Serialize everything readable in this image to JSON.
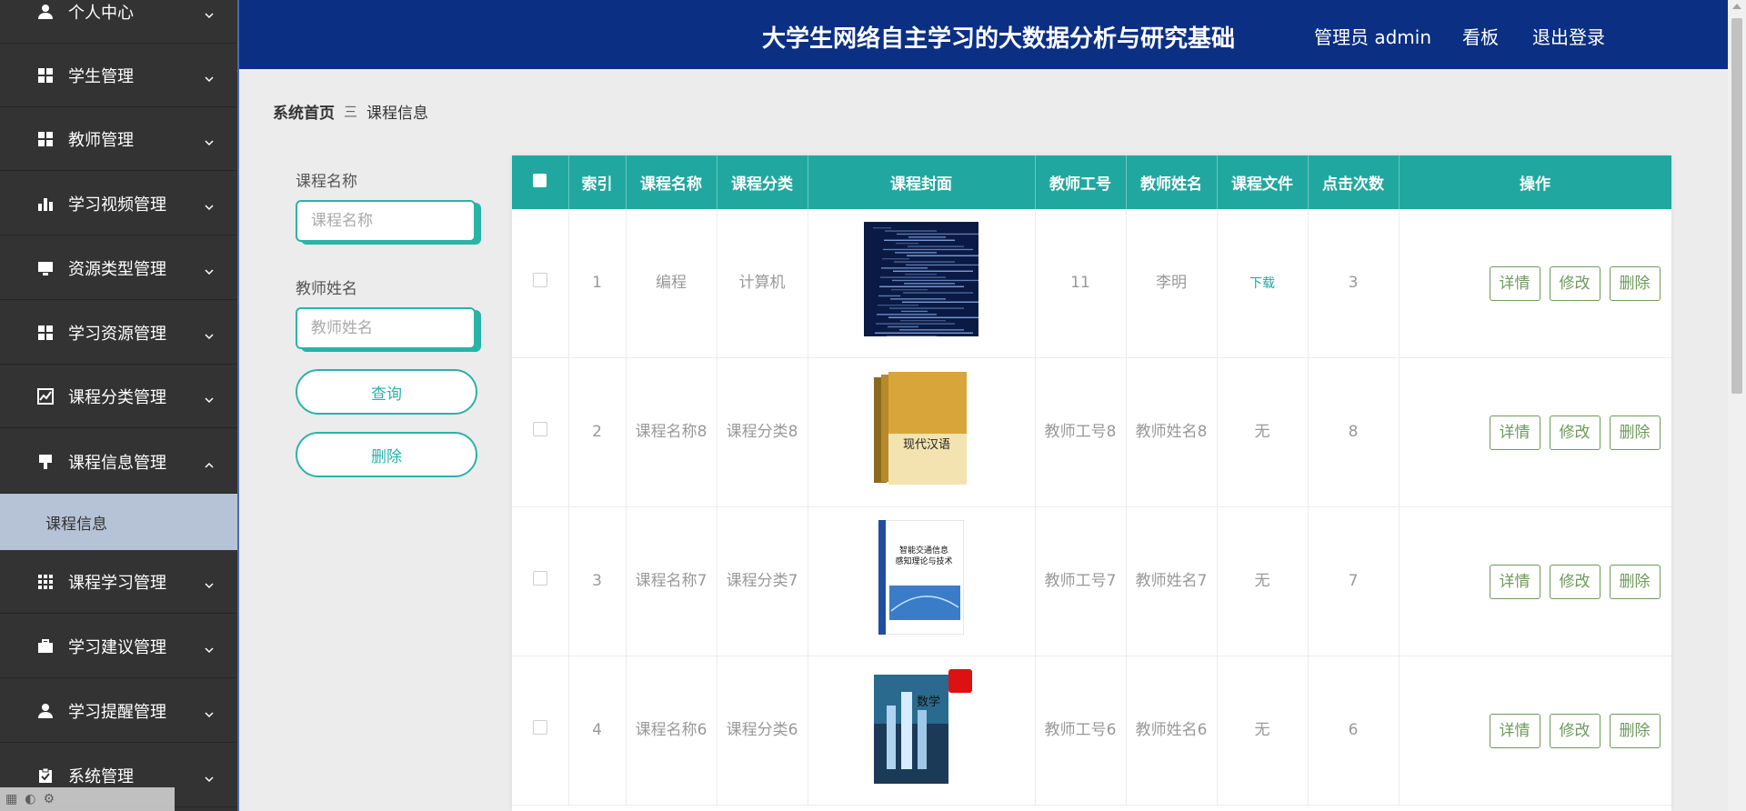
{
  "header": {
    "title": "大学生网络自主学习的大数据分析与研究基础",
    "admin": "管理员 admin",
    "dashboard": "看板",
    "logout": "退出登录"
  },
  "sidebar": {
    "items": [
      {
        "label": "个人中心",
        "icon": "user-icon"
      },
      {
        "label": "学生管理",
        "icon": "grid-icon"
      },
      {
        "label": "教师管理",
        "icon": "grid-icon"
      },
      {
        "label": "学习视频管理",
        "icon": "bar-chart-icon"
      },
      {
        "label": "资源类型管理",
        "icon": "monitor-icon"
      },
      {
        "label": "学习资源管理",
        "icon": "grid-icon"
      },
      {
        "label": "课程分类管理",
        "icon": "line-chart-icon"
      },
      {
        "label": "课程信息管理",
        "icon": "sign-icon"
      },
      {
        "label": "课程学习管理",
        "icon": "apps-icon"
      },
      {
        "label": "学习建议管理",
        "icon": "briefcase-icon"
      },
      {
        "label": "学习提醒管理",
        "icon": "user-icon"
      },
      {
        "label": "系统管理",
        "icon": "clipboard-icon"
      }
    ],
    "active_sub": "课程信息"
  },
  "breadcrumb": {
    "home": "系统首页",
    "separator": "三",
    "current": "课程信息"
  },
  "search": {
    "course_name_label": "课程名称",
    "course_name_placeholder": "课程名称",
    "teacher_name_label": "教师姓名",
    "teacher_name_placeholder": "教师姓名",
    "query_button": "查询",
    "delete_button": "删除"
  },
  "table": {
    "headers": [
      "索引",
      "课程名称",
      "课程分类",
      "课程封面",
      "教师工号",
      "教师姓名",
      "课程文件",
      "点击次数",
      "操作"
    ],
    "rows": [
      {
        "index": "1",
        "name": "编程",
        "category": "计算机",
        "teacher_no": "11",
        "teacher_name": "李明",
        "file": "下载",
        "clicks": "3"
      },
      {
        "index": "2",
        "name": "课程名称8",
        "category": "课程分类8",
        "teacher_no": "教师工号8",
        "teacher_name": "教师姓名8",
        "file": "无",
        "clicks": "8"
      },
      {
        "index": "3",
        "name": "课程名称7",
        "category": "课程分类7",
        "teacher_no": "教师工号7",
        "teacher_name": "教师姓名7",
        "file": "无",
        "clicks": "7"
      },
      {
        "index": "4",
        "name": "课程名称6",
        "category": "课程分类6",
        "teacher_no": "教师工号6",
        "teacher_name": "教师姓名6",
        "file": "无",
        "clicks": "6"
      }
    ],
    "actions": {
      "detail": "详情",
      "edit": "修改",
      "delete": "删除"
    }
  },
  "covers": {
    "row2_text": "现代汉语",
    "row3_text": "智能交通信息感知理论与技术",
    "row4_text": "数学"
  },
  "colors": {
    "header": "#0b2f83",
    "sidebar": "#333333",
    "accent": "#20a8a0",
    "action": "#6e9a5d"
  }
}
